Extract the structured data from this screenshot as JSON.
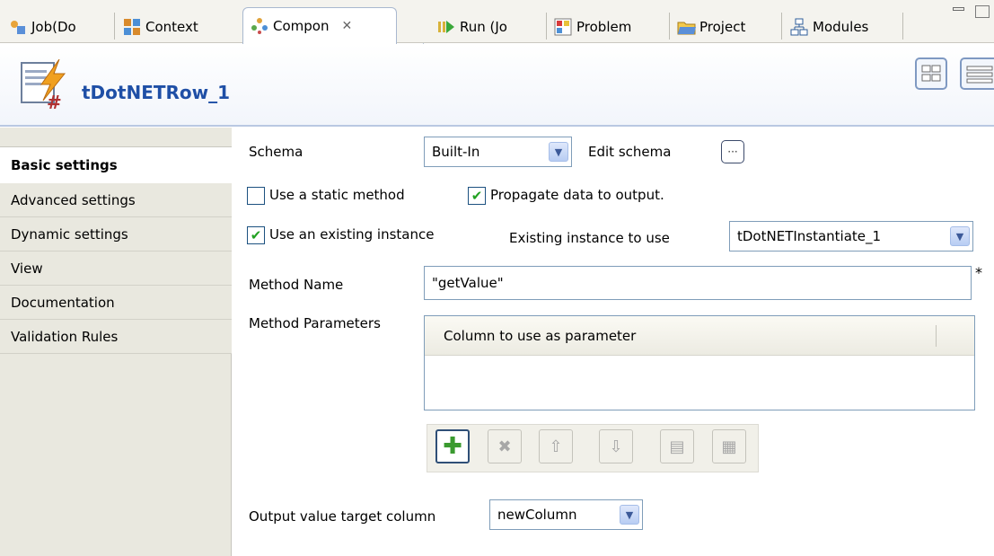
{
  "tabs": [
    {
      "label": "Job(Do",
      "icon": "job-icon"
    },
    {
      "label": "Context",
      "icon": "context-icon"
    },
    {
      "label": "Compon",
      "icon": "component-icon",
      "active": true,
      "close": "✕"
    },
    {
      "label": "Run (Jo",
      "icon": "run-icon"
    },
    {
      "label": "Problem",
      "icon": "problem-icon"
    },
    {
      "label": "Project",
      "icon": "project-icon"
    },
    {
      "label": "Modules",
      "icon": "modules-icon"
    }
  ],
  "component": {
    "title": "tDotNETRow_1",
    "icon": "dotnet-component-icon"
  },
  "nav": {
    "items": [
      {
        "label": "Basic settings",
        "active": true
      },
      {
        "label": "Advanced settings"
      },
      {
        "label": "Dynamic settings"
      },
      {
        "label": "View"
      },
      {
        "label": "Documentation"
      },
      {
        "label": "Validation Rules"
      }
    ]
  },
  "form": {
    "schema_label": "Schema",
    "schema_value": "Built-In",
    "edit_schema_label": "Edit schema",
    "edit_schema_button": "···",
    "static_method_label": "Use a static method",
    "static_method_checked": false,
    "propagate_label": "Propagate data to output.",
    "propagate_checked": true,
    "existing_instance_label": "Use an existing instance",
    "existing_instance_checked": true,
    "instance_to_use_label": "Existing instance to use",
    "instance_to_use_value": "tDotNETInstantiate_1",
    "method_name_label": "Method Name",
    "method_name_value": "\"getValue\"",
    "required_mark": "*",
    "method_params_label": "Method Parameters",
    "params_column_header": "Column to use as parameter",
    "output_target_label": "Output value target column",
    "output_target_value": "newColumn"
  },
  "toolbar": {
    "buttons": [
      {
        "name": "add",
        "glyph": "✚",
        "enabled": true
      },
      {
        "name": "remove",
        "glyph": "✖",
        "enabled": false
      },
      {
        "name": "move-up",
        "glyph": "⇧",
        "enabled": false
      },
      {
        "name": "move-down",
        "glyph": "⇩",
        "enabled": false
      },
      {
        "name": "copy",
        "glyph": "▤",
        "enabled": false
      },
      {
        "name": "paste",
        "glyph": "▦",
        "enabled": false
      }
    ]
  },
  "colors": {
    "title": "#1f4fa6",
    "check": "#21a121",
    "accent_border": "#7f9db9"
  }
}
